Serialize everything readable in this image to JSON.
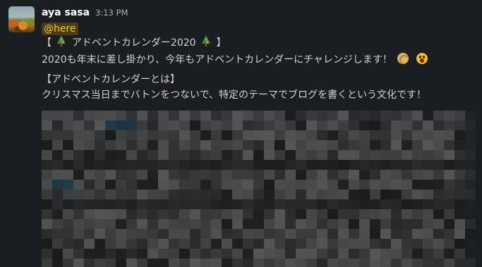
{
  "message": {
    "sender": "aya sasa",
    "timestamp": "3:13 PM",
    "mention": "@here",
    "title_prefix": "【",
    "title_text": " アドベントカレンダー2020 ",
    "title_suffix": "】",
    "line2_text": "2020も年末に差し掛かり、今年もアドベントカレンダーにチャレンジします！",
    "section_heading": "【アドベントカレンダーとは】",
    "section_body": "クリスマス当日までバトンをつないで、特定のテーマでブログを書くという文化です！"
  },
  "icons": {
    "avatar": "autumn-landscape-avatar",
    "tree": "christmas-tree-emoji",
    "biscuit": "fortune-cookie-emoji",
    "face": "surprised-face-emoji"
  },
  "colors": {
    "background": "#1a1d21",
    "mention_bg": "#4d3b15",
    "mention_fg": "#f2c744",
    "text": "#d1d2d3"
  }
}
